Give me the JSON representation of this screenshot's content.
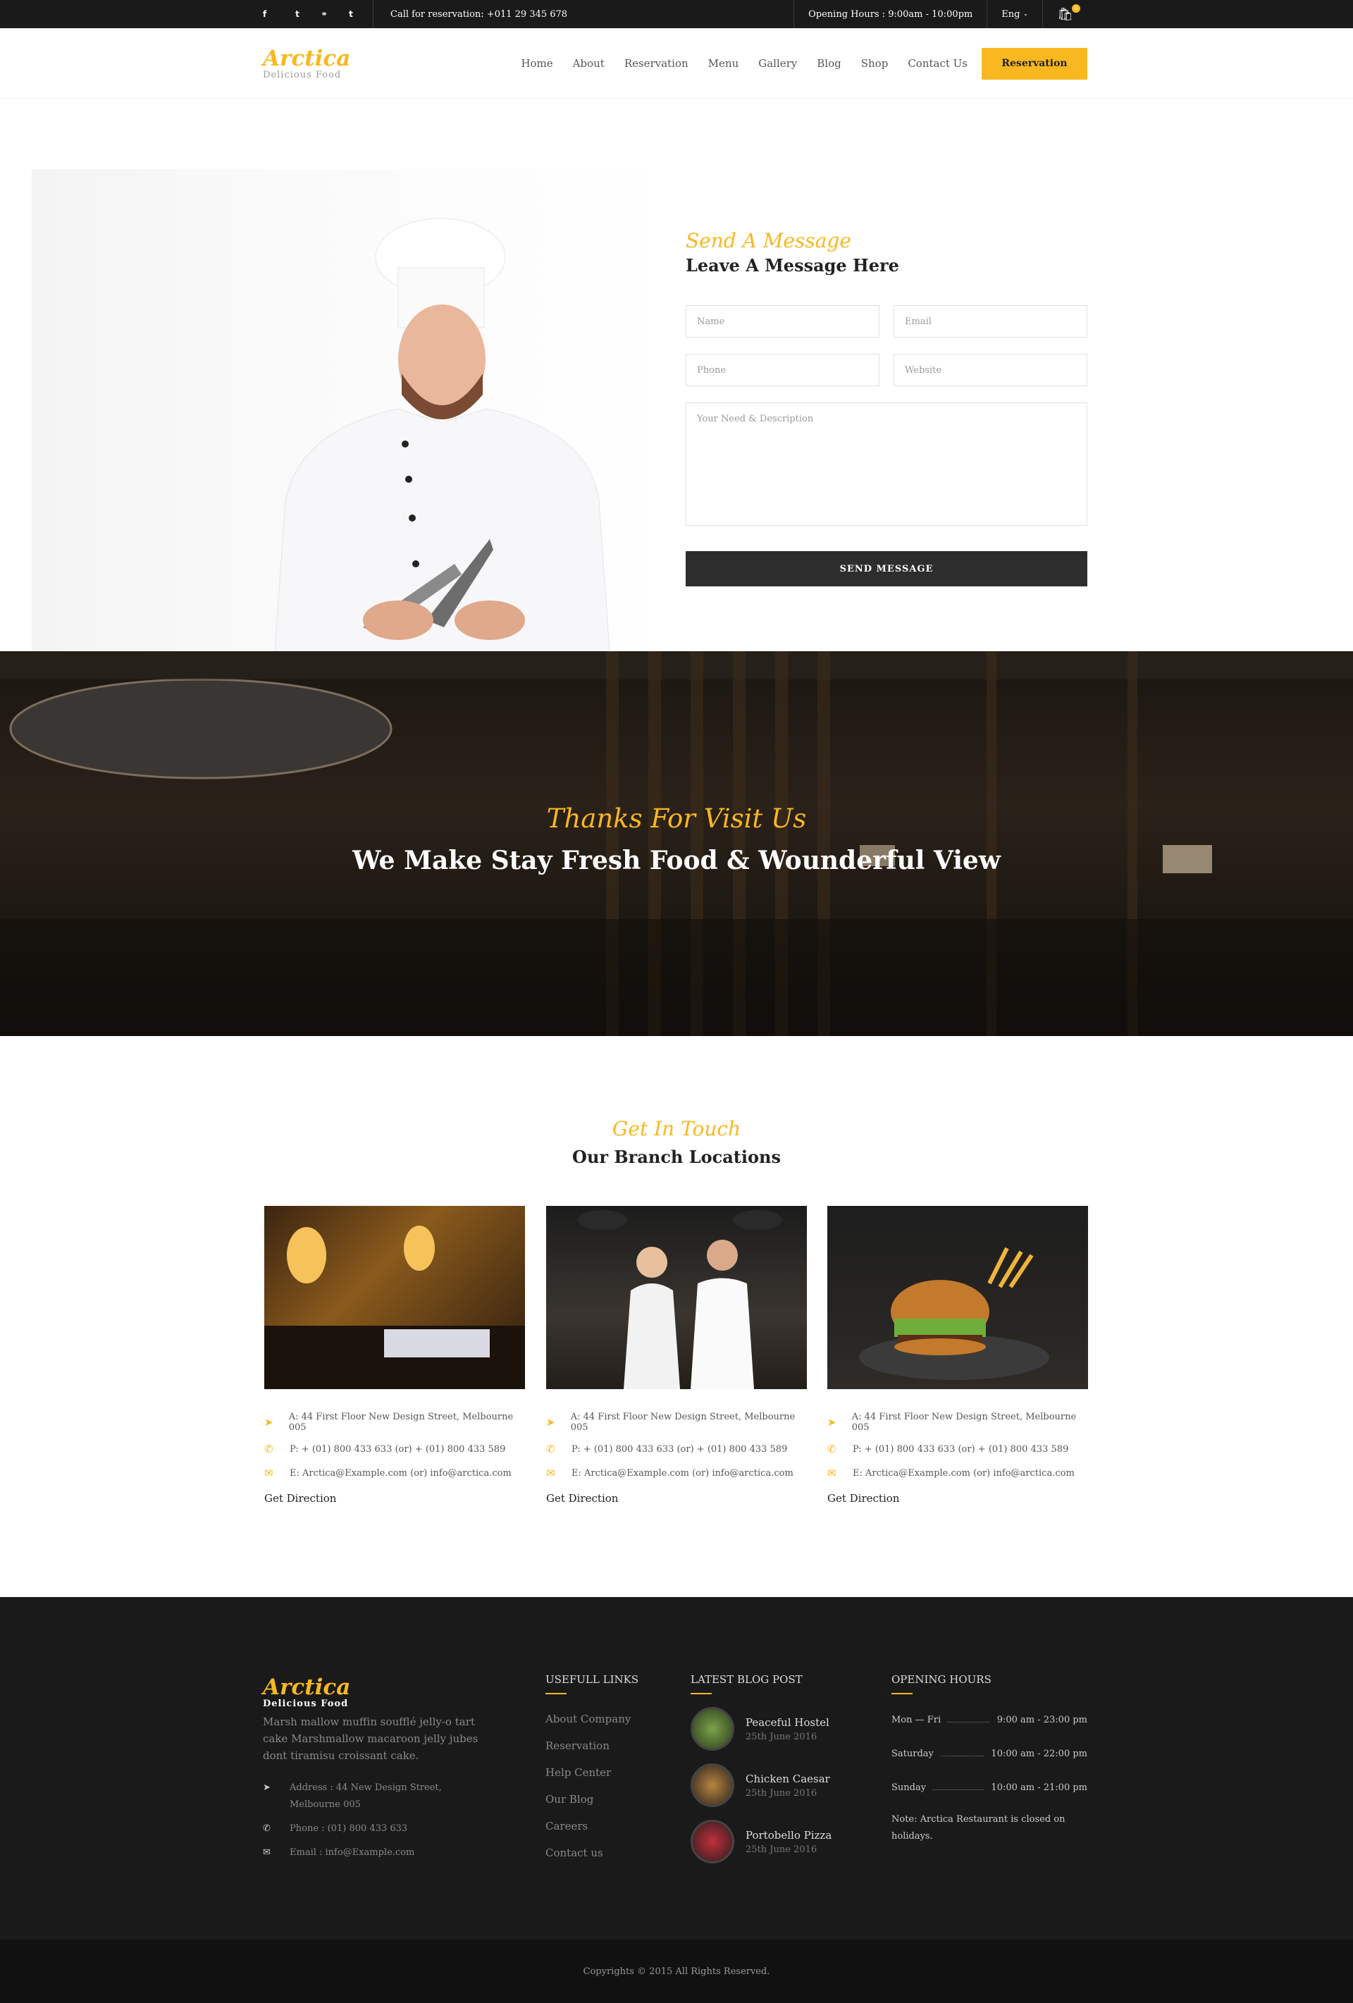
{
  "topbar": {
    "social": [
      "f",
      "t",
      "d",
      "t"
    ],
    "call": "Call for reservation: +011 29 345 678",
    "hours": "Opening Hours : 9:00am - 10:00pm",
    "lang": "Eng",
    "cart_count": "0"
  },
  "header": {
    "logo_name": "Arctica",
    "logo_tag": "Delicious Food",
    "nav": [
      "Home",
      "About",
      "Reservation",
      "Menu",
      "Gallery",
      "Blog",
      "Shop",
      "Contact Us"
    ],
    "cta": "Reservation"
  },
  "contact": {
    "script": "Send A Message",
    "title": "Leave A Message Here",
    "fields": {
      "name": "Name",
      "email": "Email",
      "phone": "Phone",
      "website": "Website",
      "description": "Your Need & Description"
    },
    "submit": "SEND MESSAGE"
  },
  "banner": {
    "script": "Thanks For Visit Us",
    "title": "We Make Stay Fresh Food & Wounderful View"
  },
  "branches": {
    "script": "Get In Touch",
    "title": "Our Branch Locations",
    "items": [
      {
        "address": "A: 44 First Floor New Design Street,  Melbourne 005",
        "phone": "P: + (01) 800 433 633  (or)  + (01) 800 433 589",
        "email": "E: Arctica@Example.com  (or)  info@arctica.com",
        "link": "Get Direction"
      },
      {
        "address": "A: 44 First Floor New Design Street,  Melbourne 005",
        "phone": "P: + (01) 800 433 633  (or)  + (01) 800 433 589",
        "email": "E: Arctica@Example.com  (or)  info@arctica.com",
        "link": "Get Direction"
      },
      {
        "address": "A: 44 First Floor New Design Street,  Melbourne 005",
        "phone": "P: + (01) 800 433 633  (or)  + (01) 800 433 589",
        "email": "E: Arctica@Example.com  (or)  info@arctica.com",
        "link": "Get Direction"
      }
    ]
  },
  "footer": {
    "logo_name": "Arctica",
    "logo_tag": "Delicious Food",
    "desc": "Marsh mallow muffin soufflé jelly-o tart cake Marshmallow macaroon jelly jubes dont tiramisu croissant cake.",
    "address_l1": "Address : 44 New Design Street,",
    "address_l2": "Melbourne 005",
    "phone": "Phone : (01) 800 433 633",
    "email": "Email : info@Example.com",
    "links_title": "USEFULL LINKS",
    "links": [
      "About Company",
      "Reservation",
      "Help Center",
      "Our Blog",
      "Careers",
      "Contact us"
    ],
    "blog_title": "LATEST BLOG POST",
    "posts": [
      {
        "title": "Peaceful Hostel",
        "date": "25th June 2016"
      },
      {
        "title": "Chicken Caesar",
        "date": "25th June 2016"
      },
      {
        "title": "Portobello Pizza",
        "date": "25th June 2016"
      }
    ],
    "hours_title": "OPENING HOURS",
    "hours": [
      {
        "day": "Mon — Fri",
        "time": "9:00 am - 23:00 pm"
      },
      {
        "day": "Saturday",
        "time": "10:00 am - 22:00 pm"
      },
      {
        "day": "Sunday",
        "time": "10:00 am - 21:00 pm"
      }
    ],
    "note": "Note: Arctica Restaurant is closed on holidays.",
    "copyright": "Copyrights © 2015  All Rights Reserved."
  },
  "colors": {
    "accent": "#f9b81f",
    "dark": "#1a1a1a",
    "button": "#2d2d2d"
  }
}
